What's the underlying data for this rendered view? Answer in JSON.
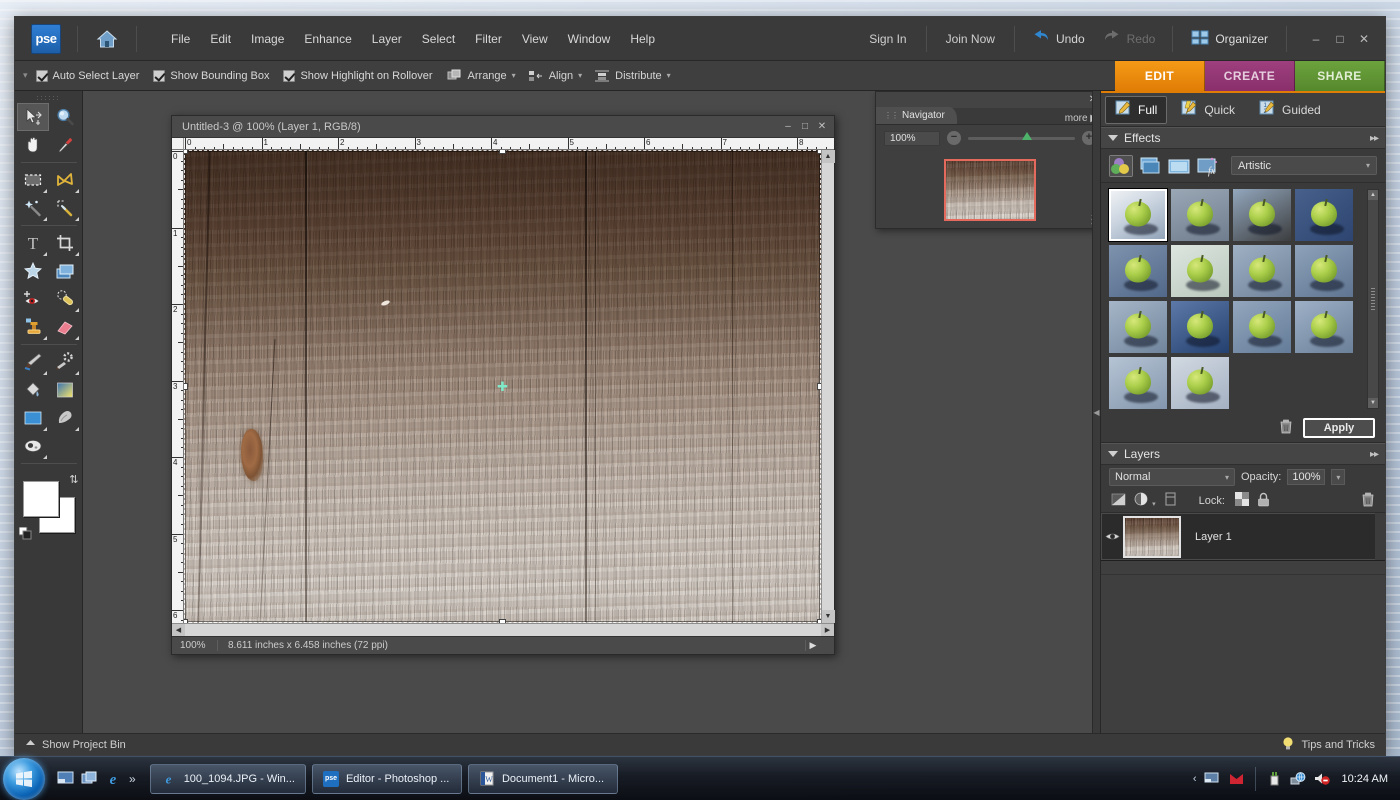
{
  "app": {
    "title": "Editor - Photoshop Elements",
    "logo_text": "pse"
  },
  "menubar": {
    "home_icon": "home-icon",
    "items": [
      "File",
      "Edit",
      "Image",
      "Enhance",
      "Layer",
      "Select",
      "Filter",
      "View",
      "Window",
      "Help"
    ],
    "sign_in": "Sign In",
    "join_now": "Join Now",
    "undo": "Undo",
    "redo": "Redo",
    "organizer": "Organizer",
    "window_buttons": {
      "minimize": "–",
      "maximize": "□",
      "close": "✕"
    }
  },
  "options_bar": {
    "checkboxes": [
      {
        "label": "Auto Select Layer",
        "checked": true
      },
      {
        "label": "Show Bounding Box",
        "checked": true
      },
      {
        "label": "Show Highlight on Rollover",
        "checked": true
      }
    ],
    "menus": [
      {
        "label": "Arrange",
        "icon": "arrange-icon"
      },
      {
        "label": "Align",
        "icon": "align-icon"
      },
      {
        "label": "Distribute",
        "icon": "distribute-icon"
      }
    ]
  },
  "mode_tabs": [
    {
      "label": "EDIT",
      "color": "#e07d05",
      "active": true
    },
    {
      "label": "CREATE",
      "color": "#8a2f6c",
      "active": false
    },
    {
      "label": "SHARE",
      "color": "#55882c",
      "active": false
    }
  ],
  "toolbox": {
    "tools": [
      {
        "name": "move-tool",
        "icon": "move-icon",
        "selected": true,
        "flyout": false
      },
      {
        "name": "zoom-tool",
        "icon": "magnifier-icon",
        "selected": false,
        "flyout": false
      },
      {
        "name": "hand-tool",
        "icon": "hand-icon",
        "selected": false,
        "flyout": false
      },
      {
        "name": "eyedropper-tool",
        "icon": "eyedropper-icon",
        "selected": false,
        "flyout": false
      },
      {
        "name": "marquee-tool",
        "icon": "rect-marquee-icon",
        "selected": false,
        "flyout": true
      },
      {
        "name": "lasso-tool",
        "icon": "lasso-icon",
        "selected": false,
        "flyout": true
      },
      {
        "name": "magic-wand-tool",
        "icon": "magic-wand-icon",
        "selected": false,
        "flyout": true
      },
      {
        "name": "quick-selection-tool",
        "icon": "quick-selection-icon",
        "selected": false,
        "flyout": true
      },
      {
        "name": "type-tool",
        "icon": "type-icon",
        "selected": false,
        "flyout": true
      },
      {
        "name": "crop-tool",
        "icon": "crop-icon",
        "selected": false,
        "flyout": true
      },
      {
        "name": "cookie-cutter-tool",
        "icon": "cookie-cutter-icon",
        "selected": false,
        "flyout": false
      },
      {
        "name": "straighten-tool",
        "icon": "straighten-icon",
        "selected": false,
        "flyout": false
      },
      {
        "name": "red-eye-removal-tool",
        "icon": "red-eye-icon",
        "selected": false,
        "flyout": false
      },
      {
        "name": "healing-brush-tool",
        "icon": "healing-brush-icon",
        "selected": false,
        "flyout": true
      },
      {
        "name": "clone-stamp-tool",
        "icon": "clone-stamp-icon",
        "selected": false,
        "flyout": true
      },
      {
        "name": "eraser-tool",
        "icon": "eraser-icon",
        "selected": false,
        "flyout": true
      },
      {
        "name": "brush-tool",
        "icon": "brush-icon",
        "selected": false,
        "flyout": true
      },
      {
        "name": "smart-brush-tool",
        "icon": "smart-brush-icon",
        "selected": false,
        "flyout": true
      },
      {
        "name": "paint-bucket-tool",
        "icon": "paint-bucket-icon",
        "selected": false,
        "flyout": false
      },
      {
        "name": "gradient-tool",
        "icon": "gradient-icon",
        "selected": false,
        "flyout": false
      },
      {
        "name": "shape-tool",
        "icon": "shape-icon",
        "selected": false,
        "flyout": true
      },
      {
        "name": "smudge-tool",
        "icon": "smudge-icon",
        "selected": false,
        "flyout": true
      },
      {
        "name": "sponge-tool",
        "icon": "sponge-icon",
        "selected": false,
        "flyout": true
      }
    ],
    "foreground_color": "#ffffff",
    "background_color": "#ffffff",
    "swap_icon": "swap-colors-icon",
    "default_icon": "default-colors-icon"
  },
  "document": {
    "title": "Untitled-3 @ 100% (Layer 1, RGB/8)",
    "window_buttons": {
      "minimize": "–",
      "maximize": "□",
      "close": "✕"
    },
    "status": {
      "zoom": "100%",
      "size": "8.611 inches x 6.458 inches (72 ppi)"
    },
    "ruler_h_labels": [
      "0",
      "1",
      "2",
      "3",
      "4",
      "5",
      "6",
      "7",
      "8"
    ],
    "ruler_v_labels": [
      "0",
      "1",
      "2",
      "3",
      "4",
      "5",
      "6"
    ],
    "ruler_unit": "inches"
  },
  "navigator": {
    "tab_label": "Navigator",
    "more_label": "more ▶",
    "zoom_value": "100%",
    "close_icon": "close-icon",
    "zoom_out_icon": "zoom-out-icon",
    "zoom_in_icon": "zoom-in-icon",
    "view_box_color": "#e46a5e"
  },
  "edit_modes": [
    {
      "label": "Full",
      "icon": "full-edit-icon",
      "active": true
    },
    {
      "label": "Quick",
      "icon": "quick-edit-icon",
      "active": false
    },
    {
      "label": "Guided",
      "icon": "guided-edit-icon",
      "active": false
    }
  ],
  "effects_panel": {
    "title": "Effects",
    "more_icon": "double-chevron-icon",
    "categories": [
      {
        "name": "filters-category",
        "icon": "filters-icon",
        "selected": true
      },
      {
        "name": "layer-styles-category",
        "icon": "layer-styles-icon",
        "selected": false
      },
      {
        "name": "photo-effects-category",
        "icon": "photo-effects-icon",
        "selected": false
      },
      {
        "name": "fx-category",
        "icon": "fx-icon",
        "selected": false
      }
    ],
    "selected_category": "Artistic",
    "thumbnail_count": 14,
    "selected_thumbnail_index": 0,
    "delete_icon": "trash-icon",
    "apply_label": "Apply"
  },
  "layers_panel": {
    "title": "Layers",
    "more_icon": "double-chevron-icon",
    "blend_mode": "Normal",
    "opacity_label": "Opacity:",
    "opacity_value": "100%",
    "lock_label": "Lock:",
    "icons": [
      {
        "name": "add-layer-mask-icon"
      },
      {
        "name": "adjustment-layer-icon"
      },
      {
        "name": "new-layer-icon"
      },
      {
        "name": "lock-transparency-icon"
      },
      {
        "name": "lock-all-icon"
      },
      {
        "name": "delete-layer-icon"
      }
    ],
    "layers": [
      {
        "name": "Layer 1",
        "visible": true,
        "selected": true
      }
    ]
  },
  "app_footer": {
    "project_bin": "Show Project Bin",
    "project_bin_icon": "eject-icon",
    "tips": "Tips and Tricks",
    "tips_icon": "lightbulb-icon"
  },
  "taskbar": {
    "start_icon": "windows-orb-icon",
    "quick_launch": [
      {
        "name": "show-desktop-icon"
      },
      {
        "name": "switch-windows-icon"
      },
      {
        "name": "internet-explorer-icon"
      }
    ],
    "quick_launch_chevron": "»",
    "tasks": [
      {
        "label": "100_1094.JPG - Win...",
        "icon": "internet-explorer-icon"
      },
      {
        "label": "Editor - Photoshop ...",
        "icon": "pse-icon"
      },
      {
        "label": "Document1 - Micro...",
        "icon": "word-icon"
      }
    ],
    "tray": {
      "chevron": "‹",
      "icons": [
        {
          "name": "network-monitor-icon"
        },
        {
          "name": "mcafee-icon"
        },
        {
          "name": "battery-plug-icon"
        },
        {
          "name": "network-globe-icon"
        },
        {
          "name": "volume-muted-icon"
        }
      ],
      "clock": "10:24 AM"
    }
  }
}
